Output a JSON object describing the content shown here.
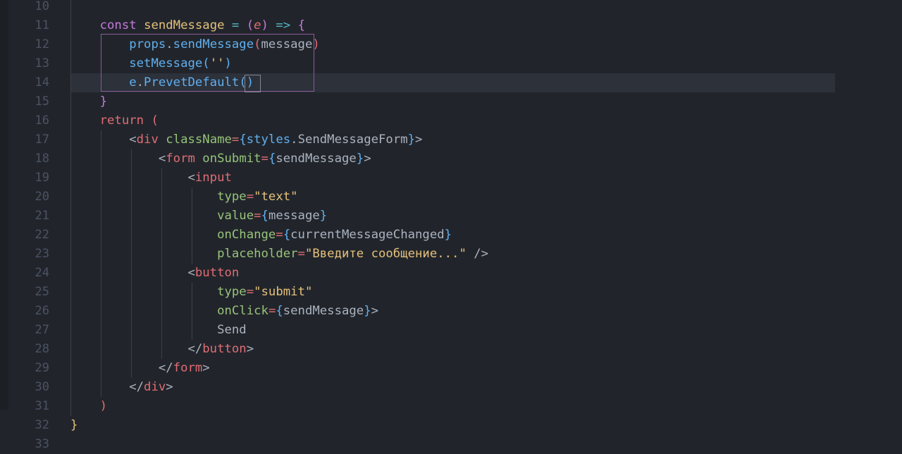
{
  "gutter": {
    "line_numbers": [
      "10",
      "11",
      "12",
      "13",
      "14",
      "15",
      "16",
      "17",
      "18",
      "19",
      "20",
      "21",
      "22",
      "23",
      "24",
      "25",
      "26",
      "27",
      "28",
      "29",
      "30",
      "31",
      "32",
      "33"
    ]
  },
  "code": {
    "l11": {
      "kw_const": "const",
      "fn_name": "sendMessage",
      "eq": " =",
      "paren_open": " (",
      "param": "e",
      "paren_close": ")",
      "arrow": " =>",
      "brace_open": " {"
    },
    "l12": {
      "obj": "props",
      "dot": ".",
      "method": "sendMessage",
      "paren_open": "(",
      "arg": "message",
      "paren_close": ")"
    },
    "l13": {
      "method": "setMessage",
      "paren_open": "(",
      "str": "''",
      "paren_close": ")"
    },
    "l14": {
      "obj": "e",
      "dot": ".",
      "method": "PrevetDefault",
      "parens": "()"
    },
    "l15": {
      "brace_close": "}"
    },
    "l16": {
      "kw_return": "return",
      "paren_open": " ("
    },
    "l17": {
      "lt": "<",
      "tag": "div",
      "attr": " className",
      "eq": "=",
      "brace_open": "{",
      "obj": "styles",
      "dot": ".",
      "prop": "SendMessageForm",
      "brace_close": "}",
      "gt": ">"
    },
    "l18": {
      "lt": "<",
      "tag": "form",
      "attr": " onSubmit",
      "eq": "=",
      "brace_open": "{",
      "value": "sendMessage",
      "brace_close": "}",
      "gt": ">"
    },
    "l19": {
      "lt": "<",
      "tag": "input"
    },
    "l20": {
      "attr": "type",
      "eq": "=",
      "str": "\"text\""
    },
    "l21": {
      "attr": "value",
      "eq": "=",
      "brace_open": "{",
      "value": "message",
      "brace_close": "}"
    },
    "l22": {
      "attr": "onChange",
      "eq": "=",
      "brace_open": "{",
      "value": "currentMessageChanged",
      "brace_close": "}"
    },
    "l23": {
      "attr": "placeholder",
      "eq": "=",
      "str": "\"Введите сообщение...\"",
      "close": " />"
    },
    "l24": {
      "lt": "<",
      "tag": "button"
    },
    "l25": {
      "attr": "type",
      "eq": "=",
      "str": "\"submit\""
    },
    "l26": {
      "attr": "onClick",
      "eq": "=",
      "brace_open": "{",
      "value": "sendMessage",
      "brace_close": "}",
      "gt": ">"
    },
    "l27": {
      "text": "Send"
    },
    "l28": {
      "lt": "</",
      "tag": "button",
      "gt": ">"
    },
    "l29": {
      "lt": "</",
      "tag": "form",
      "gt": ">"
    },
    "l30": {
      "lt": "</",
      "tag": "div",
      "gt": ">"
    },
    "l31": {
      "paren_close": ")"
    },
    "l32": {
      "brace_close": "}"
    }
  },
  "colors": {
    "background": "#21252b",
    "keyword": "#c678dd",
    "function": "#61afef",
    "string": "#e5c07b",
    "tag": "#e06c75",
    "attribute": "#98c379",
    "operator": "#56b6c2",
    "text": "#abb2bf",
    "line_number": "#4b5263",
    "current_line": "#2c313a"
  }
}
